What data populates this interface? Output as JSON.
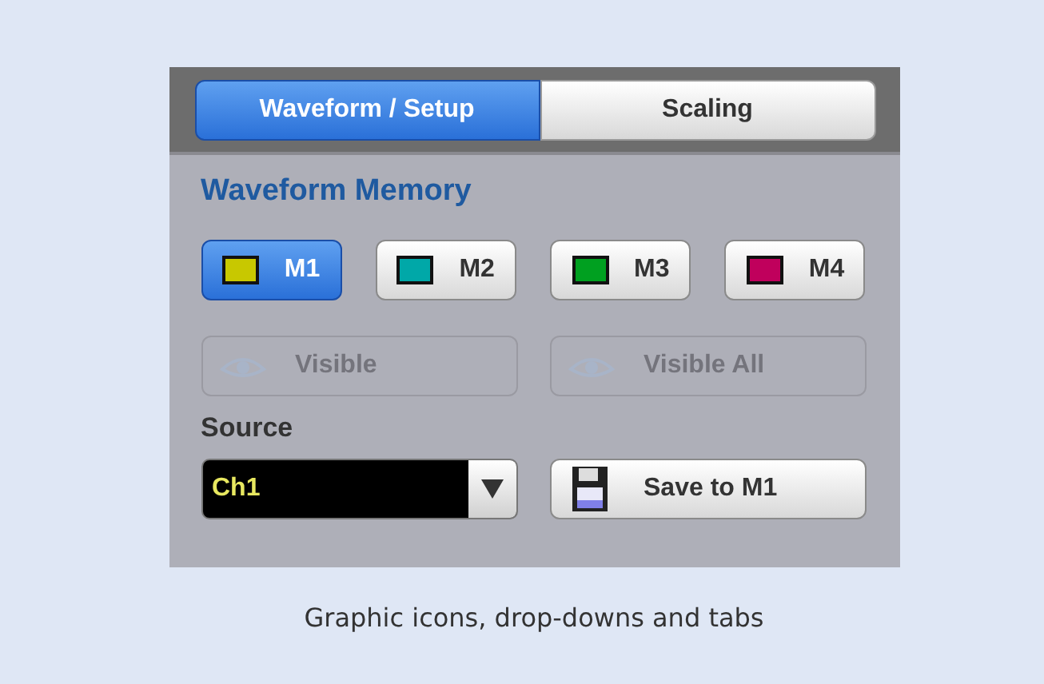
{
  "tabs": [
    {
      "label": "Waveform / Setup",
      "selected": true
    },
    {
      "label": "Scaling",
      "selected": false
    }
  ],
  "section_title": "Waveform Memory",
  "memories": [
    {
      "label": "M1",
      "color": "#c8c800",
      "selected": true
    },
    {
      "label": "M2",
      "color": "#00a8a8",
      "selected": false
    },
    {
      "label": "M3",
      "color": "#00a020",
      "selected": false
    },
    {
      "label": "M4",
      "color": "#c0005c",
      "selected": false
    }
  ],
  "visibility_buttons": [
    {
      "label": "Visible",
      "disabled": true
    },
    {
      "label": "Visible All",
      "disabled": true
    }
  ],
  "source": {
    "label": "Source",
    "value": "Ch1"
  },
  "save_button": {
    "label": "Save to M1"
  },
  "caption": "Graphic icons, drop-downs and tabs"
}
